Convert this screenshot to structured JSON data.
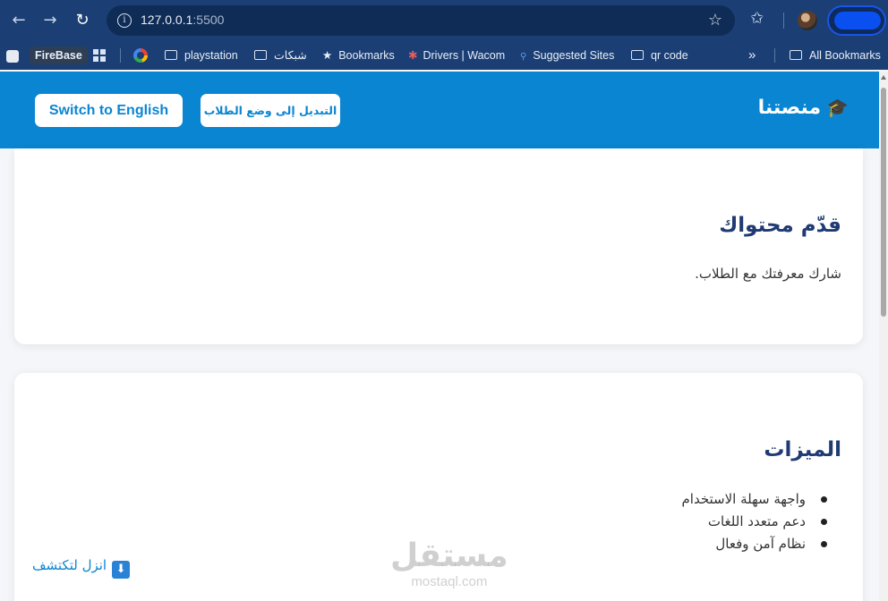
{
  "browser": {
    "url_host": "127.0.0.1",
    "url_port": ":5500",
    "icons": {
      "back": "arrow-left-icon",
      "forward": "arrow-right-icon",
      "reload": "reload-icon",
      "site_info": "info-icon",
      "bookmark_star": "star-icon",
      "extensions": "sparkle-star-icon"
    }
  },
  "bookmarks_bar": {
    "items": [
      {
        "label": "FireBase"
      },
      {
        "label": "playstation"
      },
      {
        "label": "شبكات"
      },
      {
        "label": "Bookmarks"
      },
      {
        "label": "Drivers | Wacom"
      },
      {
        "label": "Suggested Sites"
      },
      {
        "label": "qr code"
      }
    ],
    "overflow": "»",
    "all_bookmarks": "All Bookmarks"
  },
  "header": {
    "logo_icon": "🎓",
    "logo_text": "منصتنا",
    "student_mode_button": "التبديل إلى وضع الطلاب",
    "english_button": "Switch to English",
    "brand_color": "#0a85d1"
  },
  "card_submit": {
    "title": "قدّم محتواك",
    "text": "شارك معرفتك مع الطلاب."
  },
  "card_features": {
    "title": "الميزات",
    "items": [
      "واجهة سهلة الاستخدام",
      "دعم متعدد اللغات",
      "نظام آمن وفعال"
    ]
  },
  "scroll_hint": {
    "arrow": "⬇",
    "text": "انزل لتكتشف"
  },
  "watermark": {
    "arabic": "مستقل",
    "latin": "mostaql.com"
  }
}
